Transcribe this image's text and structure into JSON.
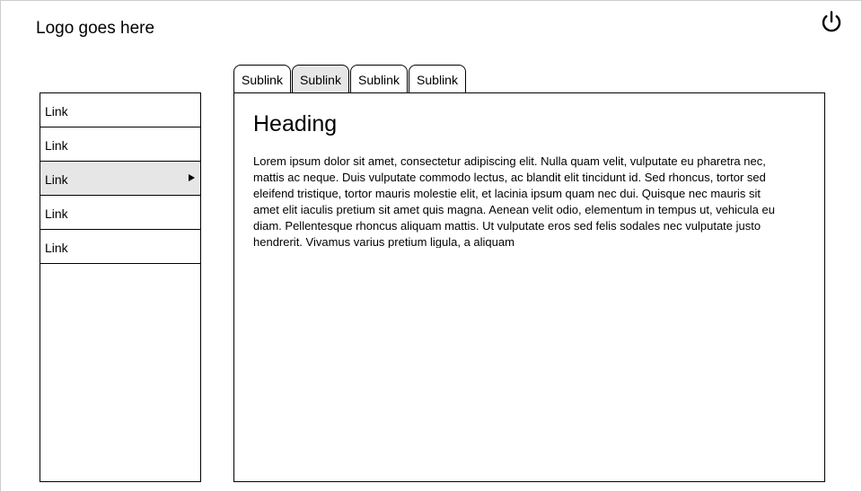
{
  "header": {
    "logo_text": "Logo goes here",
    "power_icon": "power-icon"
  },
  "sidebar": {
    "items": [
      {
        "label": "Link",
        "active": false
      },
      {
        "label": "Link",
        "active": false
      },
      {
        "label": "Link",
        "active": true,
        "icon": "triangle-right-icon"
      },
      {
        "label": "Link",
        "active": false
      },
      {
        "label": "Link",
        "active": false
      }
    ]
  },
  "tabs": {
    "items": [
      {
        "label": "Sublink",
        "active": false
      },
      {
        "label": "Sublink",
        "active": true
      },
      {
        "label": "Sublink",
        "active": false
      },
      {
        "label": "Sublink",
        "active": false
      }
    ]
  },
  "content": {
    "heading": "Heading",
    "body": "Lorem ipsum dolor sit amet, consectetur adipiscing elit. Nulla quam velit, vulputate eu pharetra nec, mattis ac neque. Duis vulputate commodo lectus, ac blandit elit tincidunt id. Sed rhoncus, tortor sed eleifend tristique, tortor mauris molestie elit, et lacinia ipsum quam nec dui. Quisque nec mauris sit amet elit iaculis pretium sit amet quis magna. Aenean velit odio, elementum in tempus ut, vehicula eu diam. Pellentesque rhoncus aliquam mattis. Ut vulputate eros sed felis sodales nec vulputate justo hendrerit. Vivamus varius pretium ligula, a aliquam"
  },
  "colors": {
    "frame_border": "#cccccc",
    "active_background": "#e6e6e6",
    "border": "#000000"
  }
}
